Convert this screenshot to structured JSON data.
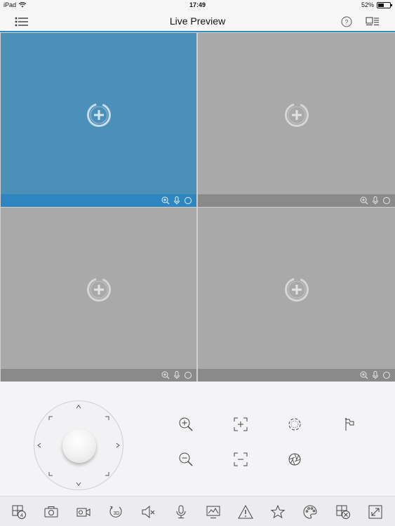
{
  "status_bar": {
    "device": "iPad",
    "time": "17:49",
    "battery": "52%",
    "battery_level": 0.52
  },
  "nav": {
    "title": "Live Preview",
    "menu_icon": "list-menu-icon",
    "help_icon": "help-icon",
    "layout_icon": "device-list-icon"
  },
  "grid": {
    "tiles": [
      {
        "selected": true,
        "add_icon": "add-camera-icon"
      },
      {
        "selected": false,
        "add_icon": "add-camera-icon"
      },
      {
        "selected": false,
        "add_icon": "add-camera-icon"
      },
      {
        "selected": false,
        "add_icon": "add-camera-icon"
      }
    ],
    "tile_bar_icons": [
      "zoom-icon",
      "microphone-icon",
      "record-icon"
    ]
  },
  "ptz": {
    "joystick": "ptz-joystick",
    "controls": [
      "zoom-in-icon",
      "zoom-out-icon",
      "focus-near-icon",
      "focus-far-icon",
      "iris-open-icon",
      "iris-close-icon",
      "preset-flag-icon"
    ]
  },
  "toolbar": {
    "split_count": "4",
    "buttons": [
      "window-split-icon",
      "capture-icon",
      "record-video-icon",
      "3d-rotate-icon",
      "audio-mute-icon",
      "talk-icon",
      "image-quality-icon",
      "alarm-icon",
      "favorite-icon",
      "palette-icon",
      "close-all-icon",
      "fullscreen-icon"
    ]
  },
  "colors": {
    "accent": "#2d86bf",
    "selected_tile": "#4a90b8",
    "tile": "#a9a9a9",
    "tile_bar": "#8a8a8a"
  }
}
